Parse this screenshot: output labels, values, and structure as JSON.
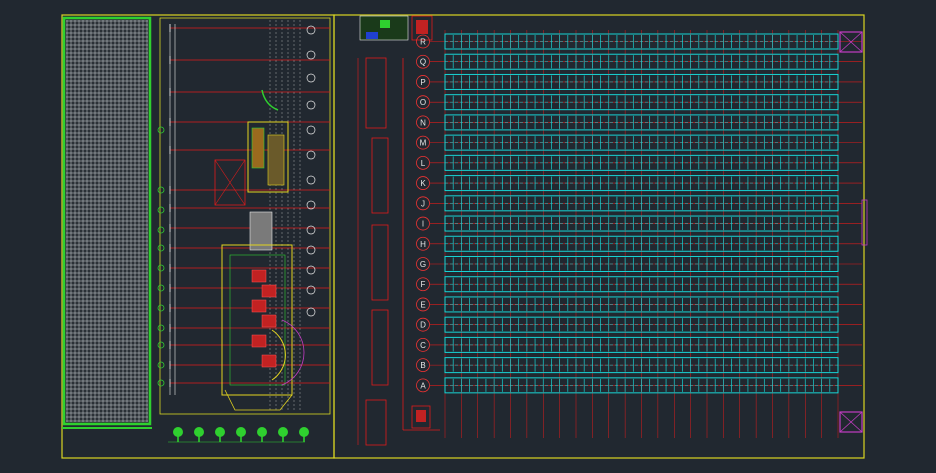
{
  "drawing": {
    "background": "#212830",
    "colors": {
      "frame": "#d9d622",
      "grid": "#18d4d4",
      "red": "#e01b1b",
      "green": "#2fd02f",
      "white": "#e8e8e8",
      "magenta": "#c23cc2",
      "yellow": "#e3d41f"
    },
    "row_labels": [
      "R",
      "Q",
      "P",
      "O",
      "N",
      "M",
      "L",
      "K",
      "J",
      "I",
      "H",
      "G",
      "F",
      "E",
      "D",
      "C",
      "B",
      "A"
    ],
    "tree_count": 7,
    "bay_count": 24
  }
}
